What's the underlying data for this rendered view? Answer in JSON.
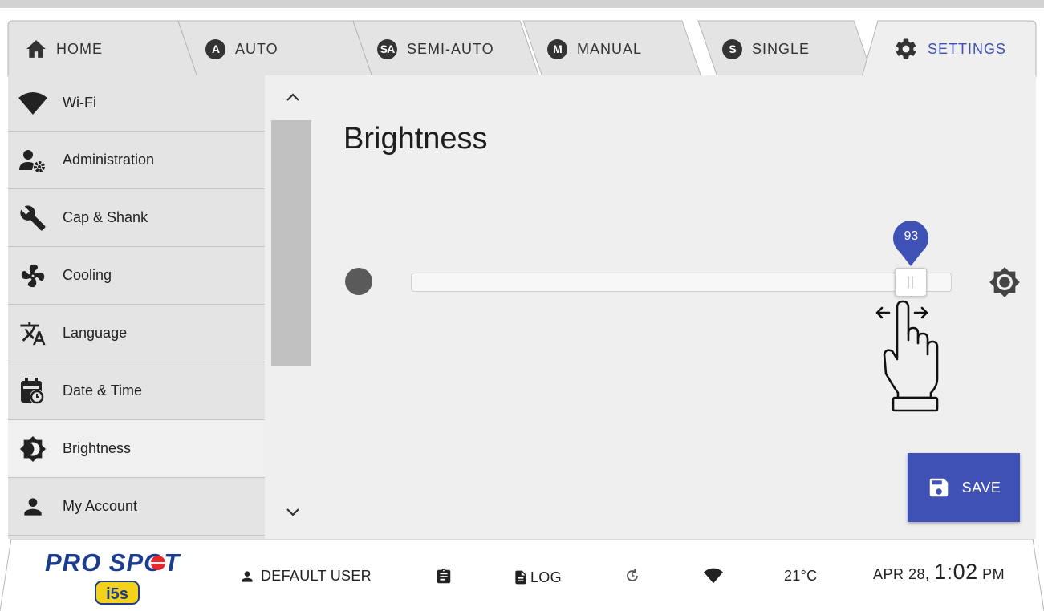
{
  "tabs": [
    {
      "label": "HOME",
      "icon": "home-icon",
      "badge": ""
    },
    {
      "label": "AUTO",
      "icon": "auto-badge-icon",
      "badge": "A"
    },
    {
      "label": "SEMI-AUTO",
      "icon": "semi-auto-badge-icon",
      "badge": "SA"
    },
    {
      "label": "MANUAL",
      "icon": "manual-badge-icon",
      "badge": "M"
    },
    {
      "label": "SINGLE",
      "icon": "single-badge-icon",
      "badge": "S"
    },
    {
      "label": "SETTINGS",
      "icon": "gear-icon",
      "badge": ""
    }
  ],
  "active_tab": "SETTINGS",
  "sidebar": {
    "items": [
      {
        "label": "Wi-Fi",
        "icon": "wifi-icon"
      },
      {
        "label": "Administration",
        "icon": "admin-icon"
      },
      {
        "label": "Cap & Shank",
        "icon": "wrench-icon"
      },
      {
        "label": "Cooling",
        "icon": "fan-icon"
      },
      {
        "label": "Language",
        "icon": "translate-icon"
      },
      {
        "label": "Date & Time",
        "icon": "calendar-clock-icon"
      },
      {
        "label": "Brightness",
        "icon": "brightness-icon"
      },
      {
        "label": "My Account",
        "icon": "person-icon"
      }
    ],
    "active": "Brightness"
  },
  "main": {
    "title": "Brightness",
    "slider": {
      "value": "93",
      "min": 0,
      "max": 100
    },
    "save_label": "SAVE"
  },
  "footer": {
    "logo_text": "PRO SPOT",
    "logo_sub": "i5s",
    "user": "DEFAULT USER",
    "log_label": "LOG",
    "temperature": "21°C",
    "date": "APR 28,",
    "time": "1:02",
    "ampm": "PM"
  },
  "colors": {
    "accent": "#3f51b5",
    "logo_blue": "#1c3c8f",
    "logo_red": "#e8262e",
    "logo_yellow": "#f5d21a"
  }
}
